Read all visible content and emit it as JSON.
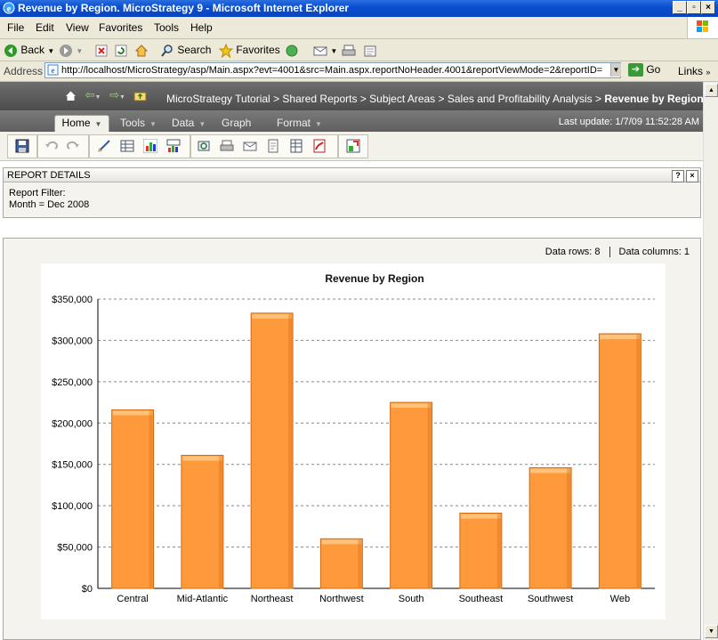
{
  "window": {
    "title": "Revenue by Region. MicroStrategy 9 - Microsoft Internet Explorer"
  },
  "menubar": {
    "items": [
      {
        "label": "File"
      },
      {
        "label": "Edit"
      },
      {
        "label": "View"
      },
      {
        "label": "Favorites"
      },
      {
        "label": "Tools"
      },
      {
        "label": "Help"
      }
    ]
  },
  "toolbar": {
    "back_label": "Back",
    "search_label": "Search",
    "favorites_label": "Favorites"
  },
  "addressbar": {
    "label": "Address",
    "url": "http://localhost/MicroStrategy/asp/Main.aspx?evt=4001&src=Main.aspx.reportNoHeader.4001&reportViewMode=2&reportID=",
    "go_label": "Go",
    "links_label": "Links"
  },
  "app": {
    "breadcrumbs": [
      "MicroStrategy Tutorial",
      "> Shared Reports",
      "> Subject Areas",
      "> Sales and Profitability Analysis",
      "> "
    ],
    "current_report": "Revenue by Region",
    "menu": {
      "home": "Home",
      "tools": "Tools",
      "data": "Data",
      "graph": "Graph",
      "format": "Format"
    },
    "last_update": "Last update: 1/7/09 11:52:28 AM"
  },
  "report_details": {
    "header": "REPORT DETAILS",
    "filter_label": "Report Filter:",
    "filter_value": "Month = Dec 2008",
    "help_label": "?",
    "close_label": "×"
  },
  "report_stats": {
    "rows": "Data rows: 8",
    "columns": "Data columns: 1"
  },
  "colors": {
    "bar": "#ff9a3c",
    "bar_top": "#ffc27a",
    "bar_edge": "#d46a10"
  },
  "chart_data": {
    "type": "bar",
    "title": "Revenue by Region",
    "categories": [
      "Central",
      "Mid-Atlantic",
      "Northeast",
      "Northwest",
      "South",
      "Southeast",
      "Southwest",
      "Web"
    ],
    "values": [
      216000,
      161000,
      333000,
      60000,
      225000,
      91000,
      146000,
      308000
    ],
    "ylim": [
      0,
      350000
    ],
    "yticks": [
      0,
      50000,
      100000,
      150000,
      200000,
      250000,
      300000,
      350000
    ],
    "ytick_labels": [
      "$0",
      "$50,000",
      "$100,000",
      "$150,000",
      "$200,000",
      "$250,000",
      "$300,000",
      "$350,000"
    ],
    "grid": true,
    "legend": "none"
  }
}
